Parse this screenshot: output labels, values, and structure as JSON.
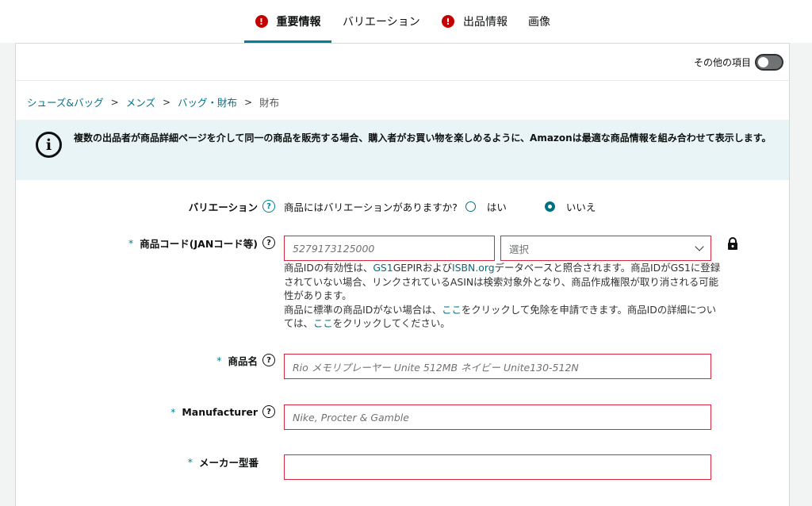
{
  "tabs": [
    {
      "label": "重要情報",
      "warning": "!"
    },
    {
      "label": "バリエーション"
    },
    {
      "label": "出品情報",
      "warning": "!"
    },
    {
      "label": "画像"
    }
  ],
  "other_items_label": "その他の項目",
  "breadcrumb": [
    "シューズ&バッグ",
    "メンズ",
    "バッグ・財布",
    "財布"
  ],
  "breadcrumb_sep": ">",
  "info": {
    "icon": "i",
    "text": "複数の出品者が商品詳細ページを介して同一の商品を販売する場合、購入者がお買い物を楽しめるように、Amazonは最適な商品情報を組み合わせて表示します。"
  },
  "variation": {
    "label": "バリエーション",
    "question": "商品にはバリエーションがありますか?",
    "yes": "はい",
    "no": "いいえ",
    "selected": "いいえ"
  },
  "product_code": {
    "required": "*",
    "label": "商品コード(JANコード等)",
    "placeholder": "5279173125000",
    "select_label": "選択",
    "help1_a": "商品IDの有効性は、",
    "help1_link1": "GS1",
    "help1_b": "GEPIRおよび",
    "help1_link2": "ISBN.org",
    "help1_c": "データベースと照合されます。商品IDがGS1に登録されていない場合、リンクされているASINは検索対象外となり、商品作成権限が取り消される可能性があります。",
    "help2_a": "商品に標準の商品IDがない場合は、",
    "help2_link1": "ここ",
    "help2_b": "をクリックして免除を申請できます。商品IDの詳細については、",
    "help2_link2": "ここ",
    "help2_c": "をクリックしてください。"
  },
  "product_name": {
    "required": "*",
    "label": "商品名",
    "placeholder": "Rio メモリプレーヤー Unite 512MB ネイビー Unite130-512N"
  },
  "manufacturer": {
    "required": "*",
    "label": "Manufacturer",
    "placeholder": "Nike, Procter & Gamble"
  },
  "model_number": {
    "required": "*",
    "label": "メーカー型番",
    "placeholder": ""
  },
  "colors": {
    "accent": "#008296",
    "link": "#007185",
    "error": "#d6283f",
    "warning": "#c40000"
  }
}
